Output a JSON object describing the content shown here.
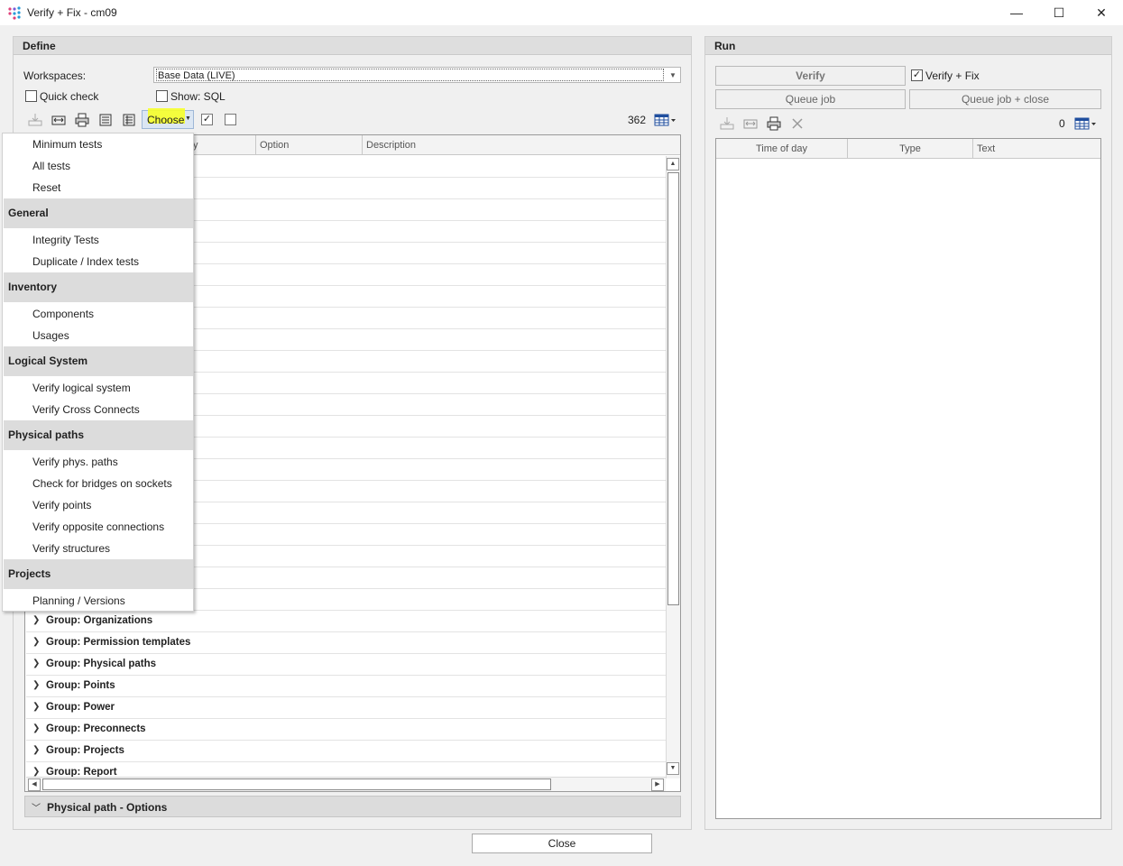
{
  "window": {
    "title": "Verify + Fix - cm09",
    "minimize": "—",
    "maximize": "☐",
    "close": "✕"
  },
  "define": {
    "header": "Define",
    "workspaces_label": "Workspaces:",
    "workspace_value": "Base Data (LIVE)",
    "quick_check_label": "Quick check",
    "quick_check_checked": false,
    "show_sql_label": "Show: SQL",
    "show_sql_checked": false,
    "choose_label": "Choose",
    "count": "362",
    "columns": [
      "y",
      "Option",
      "Description"
    ],
    "groups": [
      "Group: Organizations",
      "Group: Permission templates",
      "Group: Physical paths",
      "Group: Points",
      "Group: Power",
      "Group: Preconnects",
      "Group: Projects",
      "Group: Report"
    ],
    "options_section": "Physical path - Options"
  },
  "run": {
    "header": "Run",
    "verify_button": "Verify",
    "verify_fix_label": "Verify + Fix",
    "verify_fix_checked": true,
    "queue_job_button": "Queue job",
    "queue_job_close_button": "Queue job + close",
    "count": "0",
    "columns": [
      "Time of day",
      "Type",
      "Text"
    ]
  },
  "close_button": "Close",
  "choose_menu": {
    "top_items": [
      "Minimum tests",
      "All tests",
      "Reset"
    ],
    "sections": [
      {
        "title": "General",
        "items": [
          "Integrity Tests",
          "Duplicate / Index tests"
        ]
      },
      {
        "title": "Inventory",
        "items": [
          "Components",
          "Usages"
        ]
      },
      {
        "title": "Logical System",
        "items": [
          "Verify logical system",
          "Verify Cross Connects"
        ]
      },
      {
        "title": "Physical paths",
        "items": [
          "Verify phys. paths",
          "Check for bridges on sockets",
          "Verify points",
          "Verify opposite connections",
          "Verify structures"
        ]
      },
      {
        "title": "Projects",
        "items": [
          "Planning / Versions"
        ]
      }
    ]
  }
}
